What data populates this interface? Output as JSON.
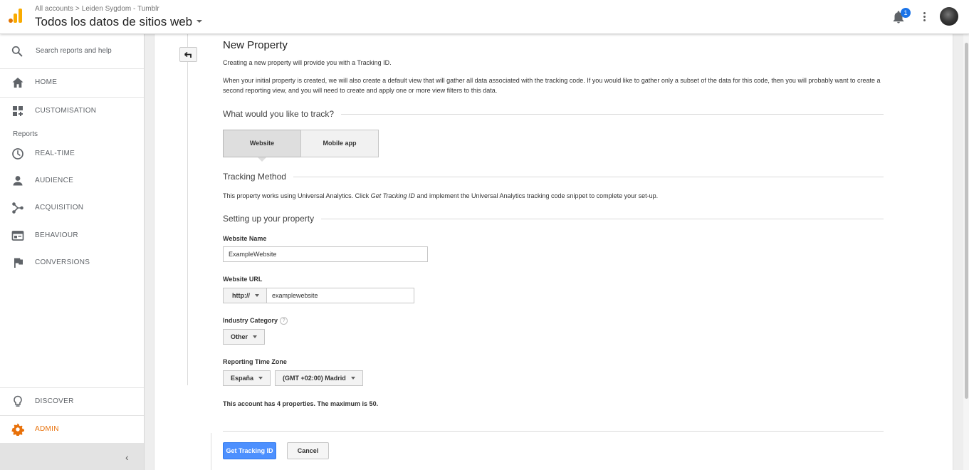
{
  "header": {
    "breadcrumb": [
      "All accounts",
      "Leiden Sygdom - Tumblr"
    ],
    "breadcrumb_sep": ">",
    "view_title": "Todos los datos de sitios web",
    "notification_count": "1"
  },
  "sidebar": {
    "search_placeholder": "Search reports and help",
    "items": [
      {
        "label": "HOME",
        "icon": "home-icon"
      },
      {
        "label": "CUSTOMISATION",
        "icon": "dashboard-add-icon"
      }
    ],
    "reports_label": "Reports",
    "report_items": [
      {
        "label": "REAL-TIME",
        "icon": "clock-icon"
      },
      {
        "label": "AUDIENCE",
        "icon": "person-icon"
      },
      {
        "label": "ACQUISITION",
        "icon": "acquisition-icon"
      },
      {
        "label": "BEHAVIOUR",
        "icon": "behaviour-icon"
      },
      {
        "label": "CONVERSIONS",
        "icon": "flag-icon"
      }
    ],
    "bottom_items": [
      {
        "label": "DISCOVER",
        "icon": "lightbulb-icon"
      },
      {
        "label": "ADMIN",
        "icon": "gear-icon"
      }
    ],
    "collapse_glyph": "‹"
  },
  "main": {
    "title": "New Property",
    "intro": "Creating a new property will provide you with a Tracking ID.",
    "description": "When your initial property is created, we will also create a default view that will gather all data associated with the tracking code. If you would like to gather only a subset of the data for this code, then you will probably want to create a second reporting view, and you will need to create and apply one or more view filters to this data.",
    "track_heading": "What would you like to track?",
    "track_options": [
      "Website",
      "Mobile app"
    ],
    "track_selected": "Website",
    "method_heading": "Tracking Method",
    "method_text_before": "This property works using Universal Analytics. Click ",
    "method_text_em": "Get Tracking ID",
    "method_text_after": " and implement the Universal Analytics tracking code snippet to complete your set-up.",
    "setup_heading": "Setting up your property",
    "website_name_label": "Website Name",
    "website_name_value": "ExampleWebsite",
    "website_url_label": "Website URL",
    "protocol_value": "http://",
    "website_url_value": "examplewebsite",
    "industry_label": "Industry Category",
    "industry_help": "?",
    "industry_value": "Other",
    "timezone_label": "Reporting Time Zone",
    "country_value": "España",
    "timezone_value": "(GMT +02:00) Madrid",
    "properties_note": "This account has 4 properties. The maximum is 50.",
    "primary_button": "Get Tracking ID",
    "cancel_button": "Cancel"
  },
  "colors": {
    "accent_blue": "#4d90fe",
    "admin_orange": "#e8710a",
    "logo_orange": "#f9ab00"
  }
}
